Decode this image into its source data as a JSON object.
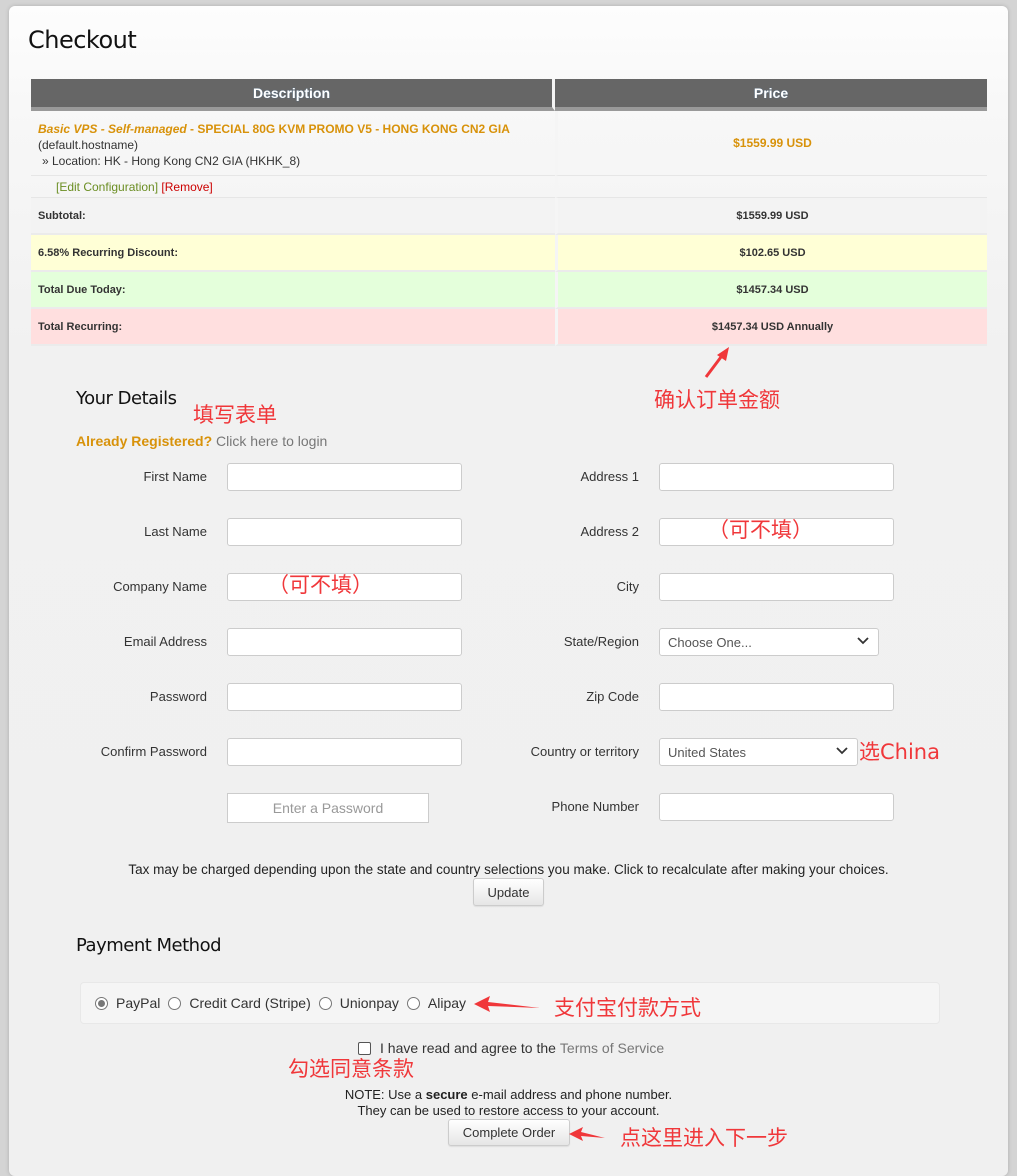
{
  "page": {
    "title": "Checkout"
  },
  "cart": {
    "headers": {
      "description": "Description",
      "price": "Price"
    },
    "item": {
      "group": "Basic VPS - Self-managed",
      "separator": " - ",
      "product": "SPECIAL 80G KVM PROMO V5 - HONG KONG CN2 GIA",
      "hostname": " (default.hostname)",
      "option": "» Location: HK - Hong Kong CN2 GIA (HKHK_8)",
      "price": "$1559.99 USD",
      "edit_link": "[Edit Configuration]",
      "remove_link": "[Remove]"
    },
    "summary": [
      {
        "label": "Subtotal:",
        "value": "$1559.99 USD",
        "color": "#f3f3f3"
      },
      {
        "label": "6.58% Recurring Discount:",
        "value": "$102.65 USD",
        "color": "#ffffd6"
      },
      {
        "label": "Total Due Today:",
        "value": "$1457.34 USD",
        "color": "#e4ffdb"
      },
      {
        "label": "Total Recurring:",
        "value": "$1457.34 USD Annually",
        "color": "#ffdfdf"
      }
    ]
  },
  "details": {
    "title": "Your Details",
    "already_registered": "Already Registered?",
    "login_link": " Click here to login",
    "left_fields": [
      {
        "label": "First Name",
        "value": ""
      },
      {
        "label": "Last Name",
        "value": ""
      },
      {
        "label": "Company Name",
        "value": ""
      },
      {
        "label": "Email Address",
        "value": ""
      },
      {
        "label": "Password",
        "value": ""
      },
      {
        "label": "Confirm Password",
        "value": ""
      }
    ],
    "password_strength": "Enter a Password",
    "right_fields": [
      {
        "label": "Address 1",
        "value": ""
      },
      {
        "label": "Address 2",
        "value": ""
      },
      {
        "label": "City",
        "value": ""
      },
      {
        "label": "State/Region",
        "selected": "Choose One..."
      },
      {
        "label": "Zip Code",
        "value": ""
      },
      {
        "label": "Country or territory",
        "selected": "United States"
      },
      {
        "label": "Phone Number",
        "value": ""
      }
    ],
    "tax_note": "Tax may be charged depending upon the state and country selections you make. Click to recalculate after making your choices.",
    "update_button": "Update"
  },
  "payment": {
    "title": "Payment Method",
    "options": [
      {
        "label": "PayPal",
        "selected": true
      },
      {
        "label": "Credit Card (Stripe)",
        "selected": false
      },
      {
        "label": "Unionpay",
        "selected": false
      },
      {
        "label": "Alipay",
        "selected": false
      }
    ],
    "tos_text": "I have read and agree to the",
    "tos_link": "Terms of Service",
    "tos_checked": false,
    "note_prefix": "NOTE: Use a ",
    "note_bold": "secure",
    "note_suffix": " e-mail address and phone number.",
    "note_line2": "They can be used to restore access to your account.",
    "complete_button": "Complete Order"
  },
  "annotations": {
    "confirm_amount": "确认订单金额",
    "fill_form": "填写表单",
    "optional_company": "（可不填）",
    "optional_address2": "（可不填）",
    "choose_china": "选China",
    "alipay_method": "支付宝付款方式",
    "agree_terms": "勾选同意条款",
    "next_step": "点这里进入下一步",
    "color": "#f0373a"
  },
  "colors": {
    "accent_orange": "#d8920a",
    "header_gray": "#666666",
    "edit_link": "#6b8e23",
    "remove_link": "#cc0000"
  }
}
